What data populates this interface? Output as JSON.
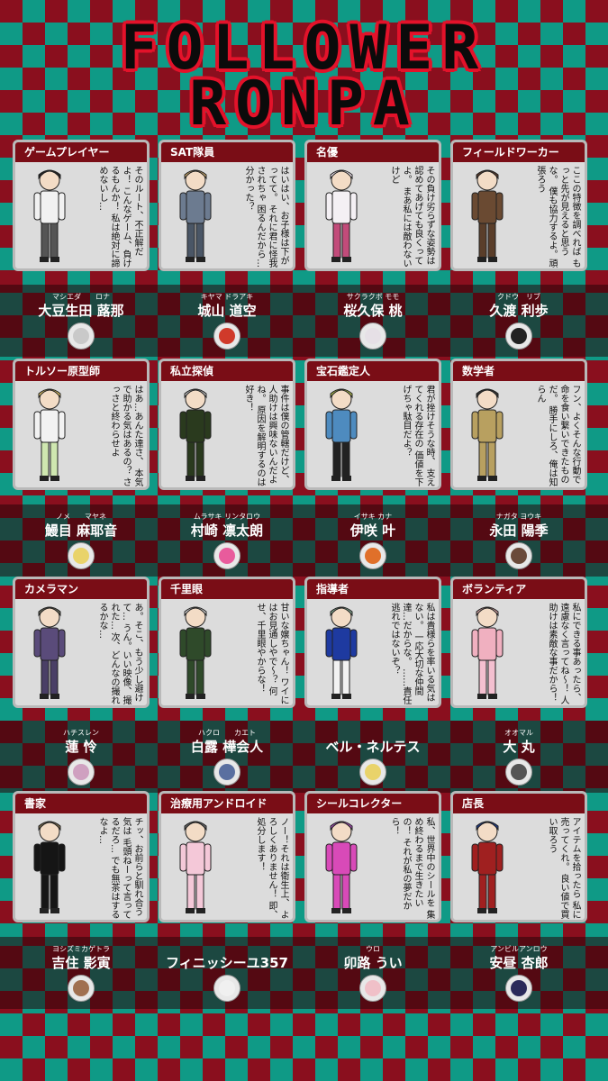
{
  "title_line1": "FOLLOWER",
  "title_line2": "RONPA",
  "cards": [
    {
      "occupation": "ゲームプレイヤー",
      "quote": "そのルート、不正解だよ！ こんなゲーム、負けるもんか！ 私は絶対に諦めないし…",
      "reading": "マシエダ　　ロナ",
      "name": "大豆生田 蕗那",
      "hair": "#222",
      "coat": "#f1f1f1",
      "pants": "#555",
      "icon": "#c9c9c9"
    },
    {
      "occupation": "SAT隊員",
      "quote": "はいはい、お子様は下がってて。 それに君に怪我されちゃ 困るんだから…分かった？",
      "reading": "キヤマ ドラアキ",
      "name": "城山 道空",
      "hair": "#c9a76a",
      "coat": "#6c7b90",
      "pants": "#4a5666",
      "icon": "#d03a2a"
    },
    {
      "occupation": "名優",
      "quote": "その負け劣らずな姿勢は 認めてあげても良くってよ。 まあ私には敵わないけど",
      "reading": "サクラクボ モモ",
      "name": "桜久保 桃",
      "hair": "#efe5ef",
      "coat": "#f4f0f4",
      "pants": "#c24b7a",
      "icon": "#e6e0e6"
    },
    {
      "occupation": "フィールドワーカー",
      "quote": "ここの特徴を調べれば もっと先が見えると思うな。 僕も協力するよ。頑張ろう",
      "reading": "クドウ　リブ",
      "name": "久渡 利歩",
      "hair": "#5b3a2a",
      "coat": "#6a4a32",
      "pants": "#5a3e2a",
      "icon": "#222"
    },
    {
      "occupation": "トルソー原型師",
      "quote": "はあ…あんた達さ、 本気で助かる気はあるの？ さっさと終わらせよ",
      "reading": "ノメ　　マヤネ",
      "name": "鰻目 麻耶音",
      "hair": "#e8c96a",
      "coat": "#f2f2f2",
      "pants": "#cfe7b0",
      "icon": "#e9d36a"
    },
    {
      "occupation": "私立探偵",
      "quote": "事件は僕の管轄だけど、 人助けは興味ないんだよね。 原因を解明するのは好き！",
      "reading": "ムラサキ リンタロウ",
      "name": "村崎 凛太朗",
      "hair": "#bdbdbd",
      "coat": "#2a3a1e",
      "pants": "#2a3a1e",
      "icon": "#e85b9c"
    },
    {
      "occupation": "宝石鑑定人",
      "quote": "君が挫けそうな時、 支えてくれる存在の 価値を下げちゃ駄目だよ？",
      "reading": "イサキ カナ",
      "name": "伊咲 叶",
      "hair": "#a9b64a",
      "coat": "#4e8bbf",
      "pants": "#222",
      "icon": "#e0702a"
    },
    {
      "occupation": "数学者",
      "quote": "フン、よくそんな行動で 命を食い繋いできたものだ。 勝手にしろ、俺は知らん",
      "reading": "ナガタ ヨウキ",
      "name": "永田 陽季",
      "hair": "#333",
      "coat": "#b8a060",
      "pants": "#b8a060",
      "icon": "#6a4a3a"
    },
    {
      "occupation": "カメラマン",
      "quote": "あ。そこ、もう少し避けて… うん。いい映像、撮れた… 次、どんなの撮れるかな…",
      "reading": "ハチスレン",
      "name": "蓮 怜",
      "hair": "#6b6b5a",
      "coat": "#5a4b7a",
      "pants": "#4a3f66",
      "icon": "#cfa0c0"
    },
    {
      "occupation": "千里眼",
      "quote": "甘いな嬢ちゃん！ ワイにはお見通しやで～？ 何せ、千里眼やからな！",
      "reading": "ハクロ　　カエト",
      "name": "白露 樺会人",
      "hair": "#d6d6d6",
      "coat": "#2f4a2a",
      "pants": "#2f4a2a",
      "icon": "#5a6fa0"
    },
    {
      "occupation": "指導者",
      "quote": "私は貴様らを率いる気はない。 一応大切な仲間達…だからな。 ……責任逃れではないぞ？",
      "reading": "",
      "name": "ベル・ネルテス",
      "hair": "#7ea08a",
      "coat": "#1e3aa0",
      "pants": "#f2f2f2",
      "icon": "#e9d36a"
    },
    {
      "occupation": "ボランティア",
      "quote": "私にできる事あったら、 遠慮なく言ってね～！ 人助けは素敵な事だから！",
      "reading": "オオマル",
      "name": "大 丸",
      "hair": "#d0a0a0",
      "coat": "#f0b0c0",
      "pants": "#f4c0d0",
      "icon": "#555"
    },
    {
      "occupation": "書家",
      "quote": "チッ、お前らと馴れ合う気は 毛頭ねーって言ってるだろ… でも無茶はするなよ…",
      "reading": "ヨシズミカゲトラ",
      "name": "吉住 影寅",
      "hair": "#7a6a4a",
      "coat": "#151515",
      "pants": "#151515",
      "icon": "#a07050"
    },
    {
      "occupation": "治療用アンドロイド",
      "quote": "ノー！それは衛生上、 よろしくありません！ 即、処分します！",
      "reading": "",
      "name": "フィニッシーユ357",
      "hair": "#666",
      "coat": "#f4c8d8",
      "pants": "#f4c8d8",
      "icon": "#f0f0f0"
    },
    {
      "occupation": "シールコレクター",
      "quote": "私、世界中のシールを 集め終わるまで生きたいの！ それが私の夢だから！",
      "reading": "ウロ",
      "name": "卯路 うい",
      "hair": "#a04ab0",
      "coat": "#d84ab8",
      "pants": "#d84ab8",
      "icon": "#f0c0c8"
    },
    {
      "occupation": "店長",
      "quote": "アイテムを拾ったら 私に売ってくれ。 良い値で買い取ろう",
      "reading": "アンビルアンロウ",
      "name": "安昼 杏郎",
      "hair": "#1e3a8a",
      "coat": "#a02020",
      "pants": "#a02020",
      "icon": "#2a2a5a"
    }
  ]
}
